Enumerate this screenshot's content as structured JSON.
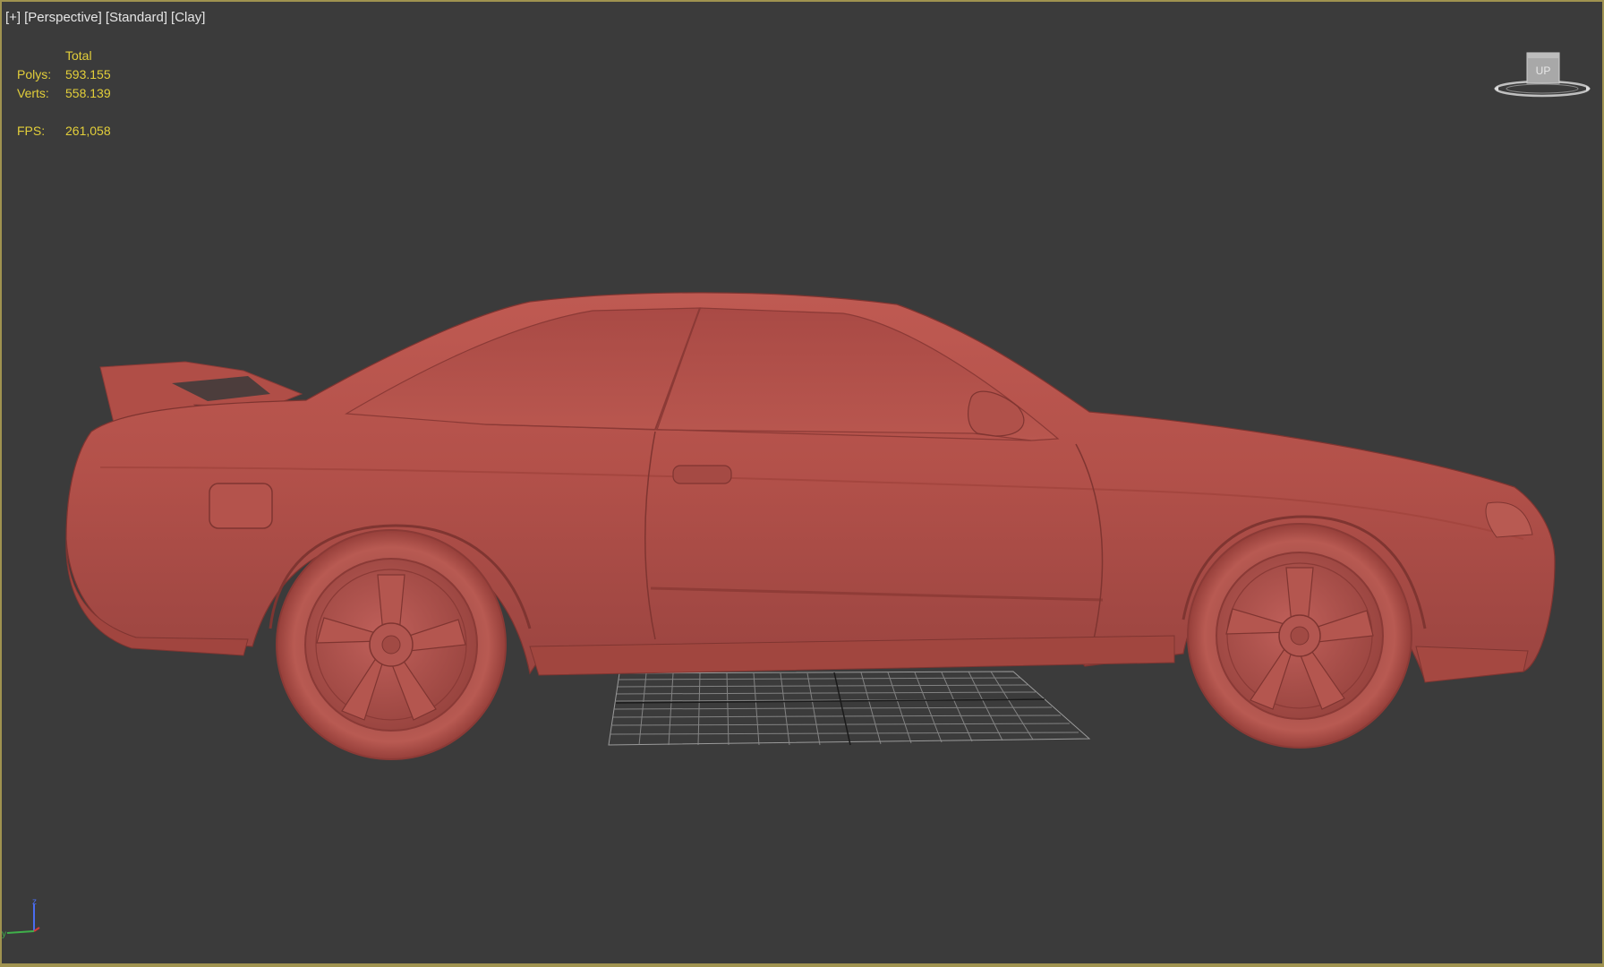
{
  "viewport": {
    "labels": [
      "[+]",
      "[Perspective]",
      "[Standard]",
      "[Clay]"
    ]
  },
  "stats": {
    "header": "Total",
    "polys_label": "Polys:",
    "polys_value": "593.155",
    "verts_label": "Verts:",
    "verts_value": "558.139",
    "fps_label": "FPS:",
    "fps_value": "261,058"
  },
  "viewcube": {
    "face_label": "UP",
    "icon": "viewcube-icon"
  },
  "scene": {
    "object": "car-model",
    "material_color": "#b0504a",
    "grid": "ground-grid"
  },
  "axis": {
    "z": "z",
    "y": "y",
    "x": "x"
  },
  "colors": {
    "background": "#3b3b3b",
    "active_border": "#a09350",
    "stats_text": "#e3cf3a",
    "label_text": "#e6e6e6"
  }
}
